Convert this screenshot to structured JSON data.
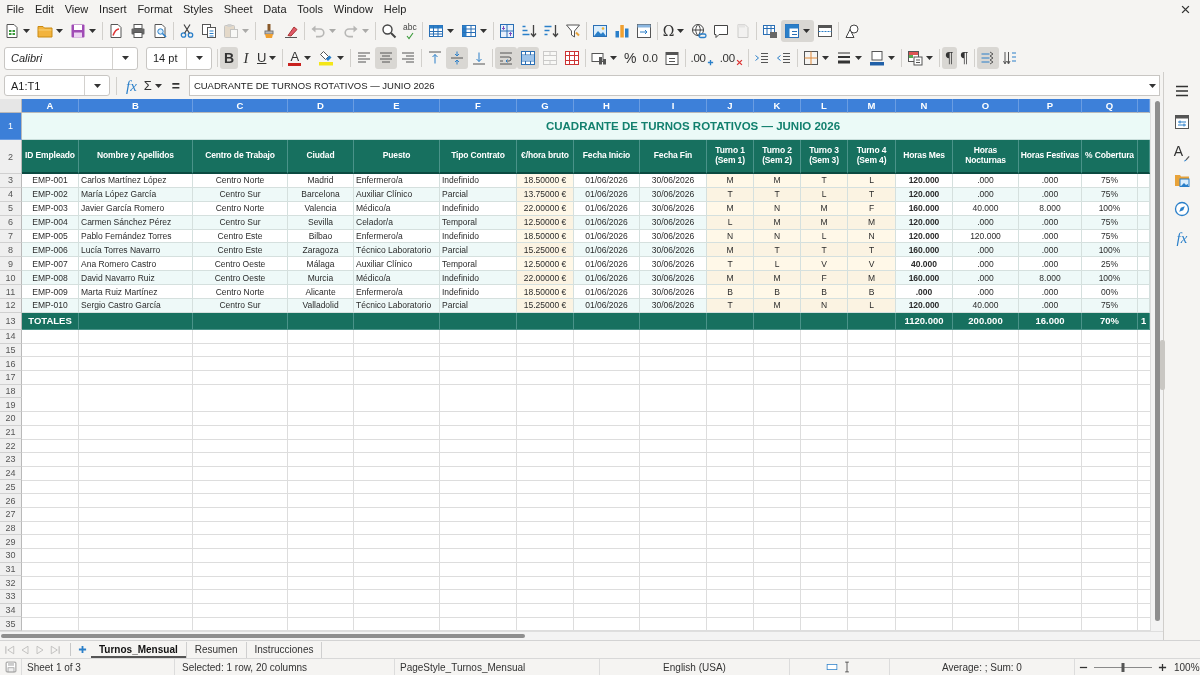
{
  "menu": [
    "File",
    "Edit",
    "View",
    "Insert",
    "Format",
    "Styles",
    "Sheet",
    "Data",
    "Tools",
    "Window",
    "Help"
  ],
  "standard_toolbar": [
    [
      {
        "kind": "new",
        "caret": true,
        "on": false,
        "disabled": false
      },
      {
        "kind": "open",
        "caret": true,
        "on": false,
        "disabled": false
      },
      {
        "kind": "save",
        "caret": true,
        "on": false,
        "disabled": false
      }
    ],
    [
      {
        "kind": "pdf",
        "caret": false,
        "on": false,
        "disabled": false
      },
      {
        "kind": "print",
        "caret": false,
        "on": false,
        "disabled": false
      },
      {
        "kind": "preview",
        "caret": false,
        "on": false,
        "disabled": false
      }
    ],
    [
      {
        "kind": "cut",
        "caret": false,
        "on": false,
        "disabled": false
      },
      {
        "kind": "copy",
        "caret": false,
        "on": false,
        "disabled": false
      },
      {
        "kind": "paste",
        "caret": true,
        "on": false,
        "disabled": true
      }
    ],
    [
      {
        "kind": "clone",
        "caret": false,
        "on": false,
        "disabled": false
      },
      {
        "kind": "clear",
        "caret": false,
        "on": false,
        "disabled": false
      }
    ],
    [
      {
        "kind": "undo",
        "caret": true,
        "on": false,
        "disabled": true
      },
      {
        "kind": "redo",
        "caret": true,
        "on": false,
        "disabled": true
      }
    ],
    [
      {
        "kind": "find",
        "caret": false,
        "on": false,
        "disabled": false
      },
      {
        "kind": "spell",
        "glyph": "abc",
        "caret": false,
        "on": false,
        "disabled": false
      }
    ],
    [
      {
        "kind": "rows",
        "caret": true,
        "on": false,
        "disabled": false
      },
      {
        "kind": "columns",
        "caret": true,
        "on": false,
        "disabled": false
      }
    ],
    [
      {
        "kind": "sort",
        "caret": false,
        "on": false,
        "disabled": false
      },
      {
        "kind": "ascending",
        "caret": false,
        "on": false,
        "disabled": false
      },
      {
        "kind": "descending",
        "caret": false,
        "on": false,
        "disabled": false
      },
      {
        "kind": "filter",
        "caret": false,
        "on": false,
        "disabled": false
      }
    ],
    [
      {
        "kind": "image",
        "caret": false,
        "on": false,
        "disabled": false
      },
      {
        "kind": "chart",
        "caret": false,
        "on": false,
        "disabled": false
      },
      {
        "kind": "pivot",
        "caret": false,
        "on": false,
        "disabled": false
      }
    ],
    [
      {
        "kind": "special",
        "glyph": "Ω",
        "caret": true,
        "on": false,
        "disabled": false
      },
      {
        "kind": "link",
        "caret": false,
        "on": false,
        "disabled": false
      },
      {
        "kind": "comment",
        "caret": false,
        "on": false,
        "disabled": false
      },
      {
        "kind": "header",
        "caret": false,
        "on": false,
        "disabled": true
      }
    ],
    [
      {
        "kind": "printarea",
        "caret": false,
        "on": false,
        "disabled": false
      },
      {
        "kind": "freeze",
        "caret": true,
        "on": true,
        "disabled": false
      },
      {
        "kind": "split",
        "caret": false,
        "on": false,
        "disabled": false
      }
    ],
    [
      {
        "kind": "draw",
        "caret": false,
        "on": false,
        "disabled": false
      }
    ]
  ],
  "formatting_toolbar": {
    "font_name": "Calibri",
    "font_size": "14 pt",
    "groups": [
      [
        {
          "kind": "bold",
          "glyph": "B",
          "caret": false,
          "on": true,
          "disabled": false
        },
        {
          "kind": "italic",
          "glyph": "I",
          "caret": false,
          "on": false,
          "disabled": false
        },
        {
          "kind": "underline",
          "glyph": "U",
          "caret": true,
          "on": false,
          "disabled": false
        }
      ],
      [
        {
          "kind": "fontcolor",
          "glyph": "A",
          "caret": true,
          "on": false,
          "disabled": false
        },
        {
          "kind": "highlight",
          "caret": true,
          "on": false,
          "disabled": false
        }
      ],
      [
        {
          "kind": "left",
          "caret": false,
          "on": false,
          "disabled": false
        },
        {
          "kind": "center",
          "caret": false,
          "on": true,
          "disabled": false
        },
        {
          "kind": "right",
          "caret": false,
          "on": false,
          "disabled": false
        }
      ],
      [
        {
          "kind": "top",
          "caret": false,
          "on": false,
          "disabled": false
        },
        {
          "kind": "middle",
          "caret": false,
          "on": true,
          "disabled": false
        },
        {
          "kind": "bottom",
          "caret": false,
          "on": false,
          "disabled": false
        }
      ],
      [
        {
          "kind": "wrap",
          "caret": false,
          "on": true,
          "disabled": false
        },
        {
          "kind": "merge",
          "caret": false,
          "on": true,
          "disabled": false
        },
        {
          "kind": "mergecells",
          "caret": false,
          "on": false,
          "disabled": true
        },
        {
          "kind": "unmerge",
          "caret": false,
          "on": false,
          "disabled": false
        }
      ],
      [
        {
          "kind": "currency",
          "caret": true,
          "on": false,
          "disabled": false
        },
        {
          "kind": "percent",
          "glyph": "%",
          "caret": false,
          "on": false,
          "disabled": false
        },
        {
          "kind": "standard",
          "glyph": "0.0",
          "caret": false,
          "on": false,
          "disabled": false
        },
        {
          "kind": "date",
          "caret": false,
          "on": false,
          "disabled": false
        }
      ],
      [
        {
          "kind": "adddecimal",
          "glyph": ".00",
          "caret": false,
          "on": false,
          "disabled": false
        },
        {
          "kind": "deldecimal",
          "glyph": ".00",
          "caret": false,
          "on": false,
          "disabled": false
        }
      ],
      [
        {
          "kind": "indent",
          "caret": false,
          "on": false,
          "disabled": false
        },
        {
          "kind": "outdent",
          "caret": false,
          "on": false,
          "disabled": false
        }
      ],
      [
        {
          "kind": "borders",
          "caret": true,
          "on": false,
          "disabled": false
        },
        {
          "kind": "borderstyle",
          "caret": true,
          "on": false,
          "disabled": false
        },
        {
          "kind": "bordercolor",
          "caret": true,
          "on": false,
          "disabled": false
        }
      ],
      [
        {
          "kind": "conditional",
          "caret": true,
          "on": false,
          "disabled": false
        }
      ],
      [
        {
          "kind": "ltr",
          "glyph": "¶",
          "caret": false,
          "on": true,
          "disabled": false
        },
        {
          "kind": "rtl",
          "glyph": "¶",
          "caret": false,
          "on": false,
          "disabled": false
        }
      ],
      [
        {
          "kind": "horizontal",
          "caret": false,
          "on": true,
          "disabled": false
        },
        {
          "kind": "vertical",
          "caret": false,
          "on": false,
          "disabled": false
        }
      ]
    ]
  },
  "formula_bar": {
    "name_box": "A1:T1",
    "wizard": "fx",
    "sum": "Σ",
    "equals": "=",
    "content": "CUADRANTE DE TURNOS ROTATIVOS — JUNIO 2026"
  },
  "sidebar": [
    {
      "kind": "properties"
    },
    {
      "kind": "styles",
      "glyph": "A"
    },
    {
      "kind": "gallery"
    },
    {
      "kind": "navigator"
    },
    {
      "kind": "functions",
      "glyph": "fx"
    }
  ],
  "sheet": {
    "columns": [
      {
        "label": "A",
        "selected": true
      },
      {
        "label": "B",
        "selected": true
      },
      {
        "label": "C",
        "selected": true
      },
      {
        "label": "D",
        "selected": true
      },
      {
        "label": "E",
        "selected": true
      },
      {
        "label": "F",
        "selected": true
      },
      {
        "label": "G",
        "selected": true
      },
      {
        "label": "H",
        "selected": true
      },
      {
        "label": "I",
        "selected": true
      },
      {
        "label": "J",
        "selected": true
      },
      {
        "label": "K",
        "selected": true
      },
      {
        "label": "L",
        "selected": true
      },
      {
        "label": "M",
        "selected": true
      },
      {
        "label": "N",
        "selected": true
      },
      {
        "label": "O",
        "selected": true
      },
      {
        "label": "P",
        "selected": true
      },
      {
        "label": "Q",
        "selected": true
      },
      {
        "selected": true
      }
    ],
    "title_row": {
      "number": "1",
      "selected": true,
      "title": "CUADRANTE DE TURNOS ROTATIVOS — JUNIO 2026"
    },
    "header_row": {
      "number": "2",
      "selected": false,
      "cells": [
        {
          "text": "ID Empleado",
          "kind": "code"
        },
        {
          "text": "Nombre y Apellidos",
          "kind": "name"
        },
        {
          "text": "Centro de Trabajo",
          "kind": "place"
        },
        {
          "text": "Ciudad",
          "kind": "place"
        },
        {
          "text": "Puesto",
          "kind": "role"
        },
        {
          "text": "Tipo Contrato",
          "kind": "role"
        },
        {
          "text": "€/hora bruto",
          "kind": "money"
        },
        {
          "text": "Fecha Inicio",
          "kind": "date"
        },
        {
          "text": "Fecha Fin",
          "kind": "date"
        },
        {
          "text": "Turno 1 (Sem 1)",
          "kind": "shift"
        },
        {
          "text": "Turno 2 (Sem 2)",
          "kind": "shift"
        },
        {
          "text": "Turno 3 (Sem 3)",
          "kind": "shift"
        },
        {
          "text": "Turno 4 (Sem 4)",
          "kind": "shift"
        },
        {
          "text": "Horas Mes",
          "kind": "hours"
        },
        {
          "text": "Horas Nocturnas",
          "kind": "number"
        },
        {
          "text": "Horas Festivas",
          "kind": "number"
        },
        {
          "text": "% Cobertura",
          "kind": "percent"
        }
      ]
    },
    "rows": [
      {
        "number": "3",
        "selected": false,
        "cells": [
          "EMP-001",
          "Carlos Martínez López",
          "Centro Norte",
          "Madrid",
          "Enfermero/a",
          "Indefinido",
          "18.50000 €",
          "01/06/2026",
          "30/06/2026",
          "M",
          "M",
          "T",
          "L",
          "120.000",
          ".000",
          ".000",
          "75%"
        ]
      },
      {
        "number": "4",
        "selected": false,
        "cells": [
          "EMP-002",
          "María López García",
          "Centro Sur",
          "Barcelona",
          "Auxiliar Clínico",
          "Parcial",
          "13.75000 €",
          "01/06/2026",
          "30/06/2026",
          "T",
          "T",
          "L",
          "T",
          "120.000",
          ".000",
          ".000",
          "75%"
        ]
      },
      {
        "number": "5",
        "selected": false,
        "cells": [
          "EMP-003",
          "Javier García Romero",
          "Centro Norte",
          "Valencia",
          "Médico/a",
          "Indefinido",
          "22.00000 €",
          "01/06/2026",
          "30/06/2026",
          "M",
          "N",
          "M",
          "F",
          "160.000",
          "40.000",
          "8.000",
          "100%"
        ]
      },
      {
        "number": "6",
        "selected": false,
        "cells": [
          "EMP-004",
          "Carmen Sánchez Pérez",
          "Centro Sur",
          "Sevilla",
          "Celador/a",
          "Temporal",
          "12.50000 €",
          "01/06/2026",
          "30/06/2026",
          "L",
          "M",
          "M",
          "M",
          "120.000",
          ".000",
          ".000",
          "75%"
        ]
      },
      {
        "number": "7",
        "selected": false,
        "cells": [
          "EMP-005",
          "Pablo Fernández Torres",
          "Centro Este",
          "Bilbao",
          "Enfermero/a",
          "Indefinido",
          "18.50000 €",
          "01/06/2026",
          "30/06/2026",
          "N",
          "N",
          "L",
          "N",
          "120.000",
          "120.000",
          ".000",
          "75%"
        ]
      },
      {
        "number": "8",
        "selected": false,
        "cells": [
          "EMP-006",
          "Lucía Torres Navarro",
          "Centro Este",
          "Zaragoza",
          "Técnico Laboratorio",
          "Parcial",
          "15.25000 €",
          "01/06/2026",
          "30/06/2026",
          "M",
          "T",
          "T",
          "T",
          "160.000",
          ".000",
          ".000",
          "100%"
        ]
      },
      {
        "number": "9",
        "selected": false,
        "cells": [
          "EMP-007",
          "Ana Romero Castro",
          "Centro Oeste",
          "Málaga",
          "Auxiliar Clínico",
          "Temporal",
          "12.50000 €",
          "01/06/2026",
          "30/06/2026",
          "T",
          "L",
          "V",
          "V",
          "40.000",
          ".000",
          ".000",
          "25%"
        ]
      },
      {
        "number": "10",
        "selected": false,
        "cells": [
          "EMP-008",
          "David Navarro Ruiz",
          "Centro Oeste",
          "Murcia",
          "Médico/a",
          "Indefinido",
          "22.00000 €",
          "01/06/2026",
          "30/06/2026",
          "M",
          "M",
          "F",
          "M",
          "160.000",
          ".000",
          "8.000",
          "100%"
        ]
      },
      {
        "number": "11",
        "selected": false,
        "cells": [
          "EMP-009",
          "Marta Ruiz Martínez",
          "Centro Norte",
          "Alicante",
          "Enfermero/a",
          "Indefinido",
          "18.50000 €",
          "01/06/2026",
          "30/06/2026",
          "B",
          "B",
          "B",
          "B",
          ".000",
          ".000",
          ".000",
          "00%"
        ]
      },
      {
        "number": "12",
        "selected": false,
        "cells": [
          "EMP-010",
          "Sergio Castro García",
          "Centro Sur",
          "Valladolid",
          "Técnico Laboratorio",
          "Parcial",
          "15.25000 €",
          "01/06/2026",
          "30/06/2026",
          "T",
          "M",
          "N",
          "L",
          "120.000",
          "40.000",
          ".000",
          "75%"
        ]
      }
    ],
    "totals_row": {
      "number": "13",
      "selected": false,
      "label": "TOTALES",
      "sums": [
        "1120.000",
        "200.000",
        "16.000",
        "70%",
        "1"
      ]
    },
    "empty_rows": [
      {
        "number": "14",
        "selected": false
      },
      {
        "number": "15",
        "selected": false
      },
      {
        "number": "16",
        "selected": false
      },
      {
        "number": "17",
        "selected": false
      },
      {
        "number": "18",
        "selected": false
      },
      {
        "number": "19",
        "selected": false
      },
      {
        "number": "20",
        "selected": false
      },
      {
        "number": "21",
        "selected": false
      },
      {
        "number": "22",
        "selected": false
      },
      {
        "number": "23",
        "selected": false
      },
      {
        "number": "24",
        "selected": false
      },
      {
        "number": "25",
        "selected": false
      },
      {
        "number": "26",
        "selected": false
      },
      {
        "number": "27",
        "selected": false
      },
      {
        "number": "28",
        "selected": false
      },
      {
        "number": "29",
        "selected": false
      },
      {
        "number": "30",
        "selected": false
      },
      {
        "number": "31",
        "selected": false
      },
      {
        "number": "32",
        "selected": false
      },
      {
        "number": "33",
        "selected": false
      },
      {
        "number": "34",
        "selected": false
      },
      {
        "number": "35",
        "selected": false
      }
    ]
  },
  "sheet_tabs": {
    "nav": [
      {
        "kind": "first",
        "disabled": true
      },
      {
        "kind": "previous",
        "disabled": true
      },
      {
        "kind": "next",
        "disabled": true
      },
      {
        "kind": "last",
        "disabled": true
      }
    ],
    "tabs": [
      {
        "label": "Turnos_Mensual",
        "selected": true
      },
      {
        "label": "Resumen",
        "selected": false
      },
      {
        "label": "Instrucciones",
        "selected": false
      }
    ]
  },
  "status_bar": {
    "sheet": "Sheet 1 of 3",
    "selection": "Selected: 1 row, 20 columns",
    "page_style": "PageStyle_Turnos_Mensual",
    "language": "English (USA)",
    "summary": "Average: ; Sum: 0",
    "zoom": {
      "level": 0.5,
      "reading": "100%"
    }
  }
}
